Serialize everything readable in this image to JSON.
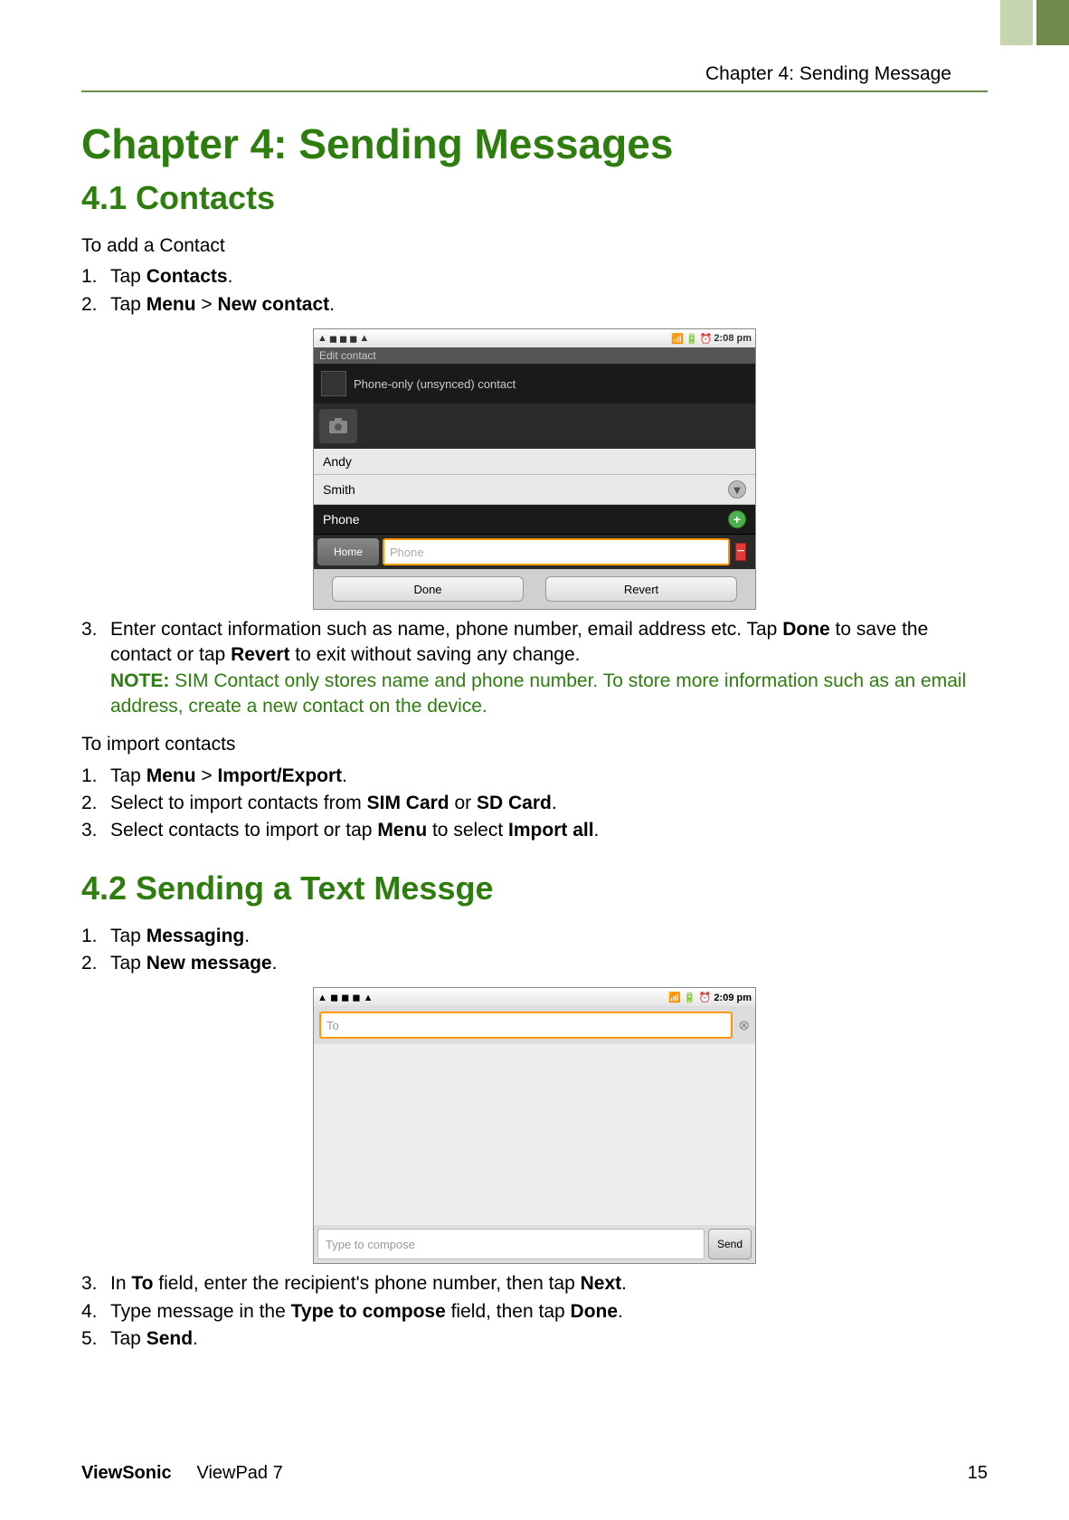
{
  "header": {
    "chapter_ref": "Chapter 4: Sending  Message"
  },
  "titles": {
    "chapter": "Chapter 4: Sending Messages",
    "section_4_1": "4.1 Contacts",
    "section_4_2": "4.2 Sending a Text Messge"
  },
  "contacts": {
    "intro": "To add a Contact",
    "step1_pre": "Tap ",
    "step1_bold": "Contacts",
    "step1_post": ".",
    "step2_pre": "Tap ",
    "step2_b1": "Menu",
    "step2_mid": " > ",
    "step2_b2": "New contact",
    "step2_post": ".",
    "step3_text_1": "Enter contact information such as name, phone number, email address etc. Tap ",
    "step3_bold_done": "Done",
    "step3_text_2": " to save the contact or tap ",
    "step3_bold_revert": "Revert",
    "step3_text_3": " to exit without saving any change.",
    "note_label": "NOTE:",
    "note_text": " SIM Contact only stores name and phone number. To store more information such as an email address, create a new contact on the device.",
    "import_intro": "To import contacts",
    "imp1_pre": "Tap ",
    "imp1_b1": "Menu",
    "imp1_mid": " > ",
    "imp1_b2": "Import/Export",
    "imp1_post": ".",
    "imp2_pre": "Select to import contacts from ",
    "imp2_b1": "SIM Card",
    "imp2_mid": " or ",
    "imp2_b2": "SD Card",
    "imp2_post": ".",
    "imp3_pre": "Select contacts to import or tap ",
    "imp3_b1": "Menu",
    "imp3_mid": " to select ",
    "imp3_b2": "Import all",
    "imp3_post": "."
  },
  "messaging": {
    "step1_pre": "Tap ",
    "step1_b": "Messaging",
    "step1_post": ".",
    "step2_pre": "Tap ",
    "step2_b": "New message",
    "step2_post": ".",
    "step3_pre": "In ",
    "step3_b1": "To",
    "step3_mid": " field, enter the recipient's phone number, then tap ",
    "step3_b2": "Next",
    "step3_post": ".",
    "step4_pre": "Type message in the ",
    "step4_b1": "Type to compose",
    "step4_mid": " field, then tap ",
    "step4_b2": "Done",
    "step4_post": ".",
    "step5_pre": "Tap ",
    "step5_b": "Send",
    "step5_post": "."
  },
  "screenshot1": {
    "time": "2:08 pm",
    "edit_contact_label": "Edit contact",
    "unsynced_label": "Phone-only (unsynced) contact",
    "first_name": "Andy",
    "last_name": "Smith",
    "section_phone": "Phone",
    "home_label": "Home",
    "phone_placeholder": "Phone",
    "done_btn": "Done",
    "revert_btn": "Revert"
  },
  "screenshot2": {
    "time": "2:09 pm",
    "to_placeholder": "To",
    "compose_placeholder": "Type to compose",
    "send_btn": "Send"
  },
  "footer": {
    "brand": "ViewSonic",
    "product": "ViewPad 7",
    "page": "15"
  }
}
